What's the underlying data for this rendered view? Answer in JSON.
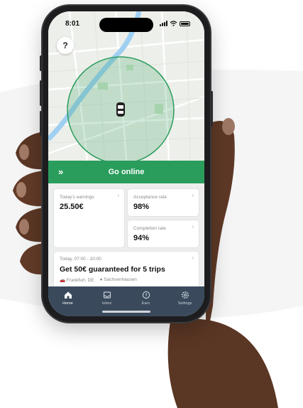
{
  "status_bar": {
    "time": "8:01"
  },
  "map": {
    "help_label": "?"
  },
  "go_online": {
    "label": "Go online",
    "color": "#2a9d5c"
  },
  "stats": {
    "earnings": {
      "caption": "Today's earnings",
      "value": "25.50€"
    },
    "acceptance": {
      "caption": "Acceptance rate",
      "value": "98%"
    },
    "completion": {
      "caption": "Completion rate",
      "value": "94%"
    }
  },
  "promo": {
    "date": "Today, 07:00 - 10:00",
    "title": "Get 50€ guaranteed for 5 trips",
    "meta_location": "Frankfurt, DE",
    "meta_zone": "Sachsenhausen"
  },
  "tabs": [
    {
      "label": "Home",
      "icon": "home-icon",
      "active": true
    },
    {
      "label": "Inbox",
      "icon": "inbox-icon",
      "active": false
    },
    {
      "label": "Earn",
      "icon": "earnings-icon",
      "active": false
    },
    {
      "label": "Settings",
      "icon": "gear-icon",
      "active": false
    }
  ],
  "colors": {
    "accent": "#2a9d5c",
    "tabbar": "#3a4a5c",
    "phone": "#1d1d1f"
  }
}
